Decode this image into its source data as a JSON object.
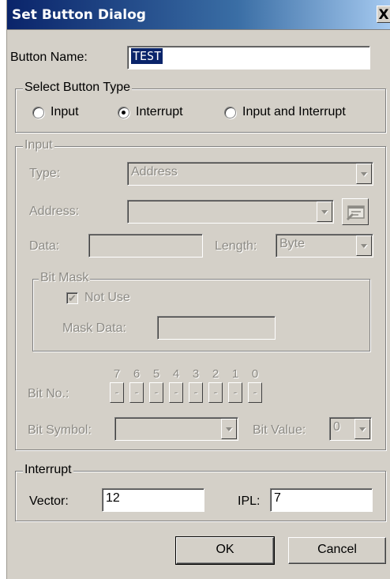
{
  "title": "Set Button Dialog",
  "close_glyph": "X",
  "button_name": {
    "label": "Button Name:",
    "value": "TEST"
  },
  "select_type": {
    "title": "Select Button Type",
    "options": [
      {
        "label": "Input",
        "selected": false
      },
      {
        "label": "Interrupt",
        "selected": true
      },
      {
        "label": "Input and Interrupt",
        "selected": false
      }
    ]
  },
  "input": {
    "title": "Input",
    "type_label": "Type:",
    "type_value": "Address",
    "address_label": "Address:",
    "address_value": "",
    "data_label": "Data:",
    "data_value": "",
    "length_label": "Length:",
    "length_value": "Byte",
    "bitmask": {
      "title": "Bit Mask",
      "not_use_label": "Not Use",
      "not_use_checked": true,
      "mask_data_label": "Mask Data:",
      "mask_data_value": ""
    },
    "bit_no_label": "Bit No.:",
    "bits": [
      {
        "num": "7",
        "val": "-"
      },
      {
        "num": "6",
        "val": "-"
      },
      {
        "num": "5",
        "val": "-"
      },
      {
        "num": "4",
        "val": "-"
      },
      {
        "num": "3",
        "val": "-"
      },
      {
        "num": "2",
        "val": "-"
      },
      {
        "num": "1",
        "val": "-"
      },
      {
        "num": "0",
        "val": "-"
      }
    ],
    "bit_symbol_label": "Bit Symbol:",
    "bit_symbol_value": "",
    "bit_value_label": "Bit Value:",
    "bit_value_value": "0"
  },
  "interrupt": {
    "title": "Interrupt",
    "vector_label": "Vector:",
    "vector_value": "12",
    "ipl_label": "IPL:",
    "ipl_value": "7"
  },
  "buttons": {
    "ok": "OK",
    "cancel": "Cancel"
  },
  "icons": {
    "browse": "address-browse-icon",
    "dropdown": "chevron-down-icon"
  },
  "colors": {
    "titlebar_start": "#0a246a",
    "titlebar_end": "#a6caf0",
    "face": "#d4d0c8",
    "disabled_text": "#8c8a84"
  }
}
